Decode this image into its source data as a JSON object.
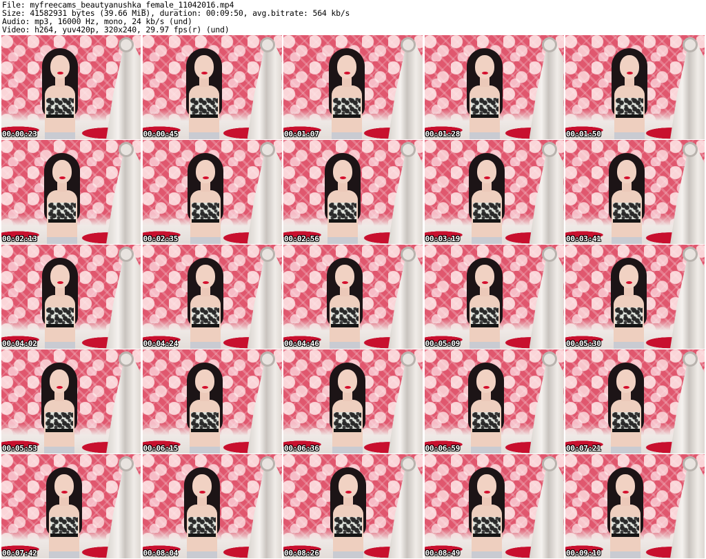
{
  "header": {
    "file_line": "File: myfreecams_beautyanushka_female_11042016.mp4",
    "size_line": "Size: 41582931 bytes (39.66 MiB), duration: 00:09:50, avg.bitrate: 564 kb/s",
    "audio_line": "Audio: mp3, 16000 Hz, mono, 24 kb/s (und)",
    "video_line": "Video: h264, yuv420p, 320x240, 29.97 fps(r) (und)"
  },
  "thumbnails": [
    {
      "timestamp": "00:00:23"
    },
    {
      "timestamp": "00:00:45"
    },
    {
      "timestamp": "00:01:07"
    },
    {
      "timestamp": "00:01:28"
    },
    {
      "timestamp": "00:01:50"
    },
    {
      "timestamp": "00:02:13"
    },
    {
      "timestamp": "00:02:35"
    },
    {
      "timestamp": "00:02:56"
    },
    {
      "timestamp": "00:03:19"
    },
    {
      "timestamp": "00:03:41"
    },
    {
      "timestamp": "00:04:02"
    },
    {
      "timestamp": "00:04:24"
    },
    {
      "timestamp": "00:04:46"
    },
    {
      "timestamp": "00:05:09"
    },
    {
      "timestamp": "00:05:30"
    },
    {
      "timestamp": "00:05:53"
    },
    {
      "timestamp": "00:06:15"
    },
    {
      "timestamp": "00:06:36"
    },
    {
      "timestamp": "00:06:59"
    },
    {
      "timestamp": "00:07:21"
    },
    {
      "timestamp": "00:07:42"
    },
    {
      "timestamp": "00:08:04"
    },
    {
      "timestamp": "00:08:26"
    },
    {
      "timestamp": "00:08:49"
    },
    {
      "timestamp": "00:09:10"
    }
  ]
}
